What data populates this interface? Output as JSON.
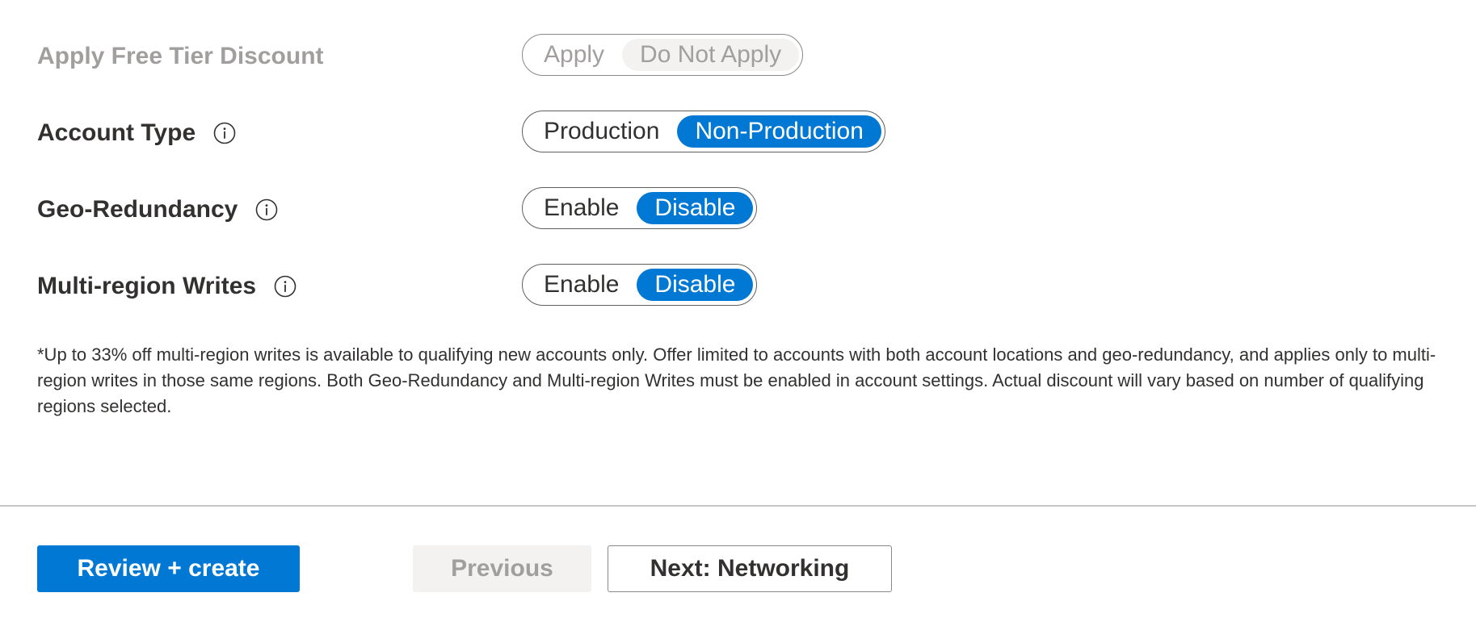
{
  "settings": {
    "free_tier": {
      "label": "Apply Free Tier Discount",
      "options": [
        "Apply",
        "Do Not Apply"
      ],
      "selected": "Do Not Apply",
      "disabled": true
    },
    "account_type": {
      "label": "Account Type",
      "options": [
        "Production",
        "Non-Production"
      ],
      "selected": "Non-Production"
    },
    "geo_redundancy": {
      "label": "Geo-Redundancy",
      "options": [
        "Enable",
        "Disable"
      ],
      "selected": "Disable"
    },
    "multi_region_writes": {
      "label": "Multi-region Writes",
      "options": [
        "Enable",
        "Disable"
      ],
      "selected": "Disable"
    }
  },
  "footnote": "*Up to 33% off multi-region writes is available to qualifying new accounts only. Offer limited to accounts with both account locations and geo-redundancy, and applies only to multi-region writes in those same regions. Both Geo-Redundancy and Multi-region Writes must be enabled in account settings. Actual discount will vary based on number of qualifying regions selected.",
  "footer": {
    "review_create": "Review + create",
    "previous": "Previous",
    "next": "Next: Networking"
  },
  "colors": {
    "accent": "#0078d4",
    "text": "#323130",
    "disabled_text": "#a19f9d"
  },
  "icons": {
    "info": "info-icon"
  }
}
